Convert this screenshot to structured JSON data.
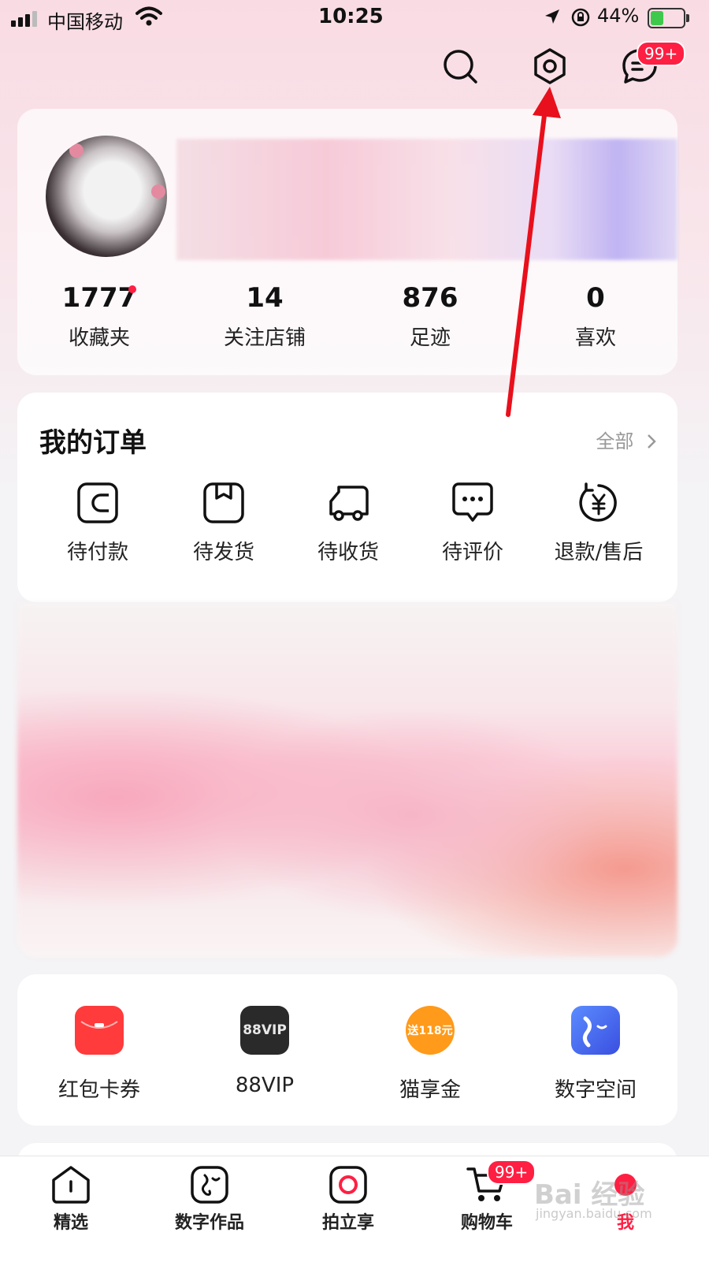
{
  "status_bar": {
    "carrier": "中国移动",
    "time": "10:25",
    "battery_percent": "44%",
    "battery_level": 0.44
  },
  "header": {
    "icons": [
      "search-icon",
      "gear-icon",
      "message-icon"
    ],
    "message_badge": "99+"
  },
  "profile": {
    "stats": [
      {
        "value": "1777",
        "label": "收藏夹"
      },
      {
        "value": "14",
        "label": "关注店铺"
      },
      {
        "value": "876",
        "label": "足迹"
      },
      {
        "value": "0",
        "label": "喜欢"
      }
    ]
  },
  "orders": {
    "title": "我的订单",
    "all_label": "全部",
    "items": [
      {
        "label": "待付款",
        "icon": "wallet-icon"
      },
      {
        "label": "待发货",
        "icon": "box-icon"
      },
      {
        "label": "待收货",
        "icon": "truck-icon"
      },
      {
        "label": "待评价",
        "icon": "comment-icon"
      },
      {
        "label": "退款/售后",
        "icon": "refund-icon"
      }
    ]
  },
  "services": [
    {
      "label": "红包卡券",
      "icon": "red-envelope-icon",
      "color": "#ff3b3b"
    },
    {
      "label": "88VIP",
      "icon": "vip-icon",
      "icon_text": "88VIP",
      "color": "#222222"
    },
    {
      "label": "猫享金",
      "icon": "coin-icon",
      "icon_text": "送118元",
      "color": "#ff8a00"
    },
    {
      "label": "数字空间",
      "icon": "digital-space-icon",
      "color": "#3a6df0"
    }
  ],
  "tabbar": {
    "items": [
      {
        "label": "精选",
        "icon": "home-icon"
      },
      {
        "label": "数字作品",
        "icon": "art-icon"
      },
      {
        "label": "拍立享",
        "icon": "camera-icon"
      },
      {
        "label": "购物车",
        "icon": "cart-icon",
        "badge": "99+"
      },
      {
        "label": "我",
        "icon": "me-icon"
      }
    ]
  },
  "watermark": {
    "text": "Bai 经验",
    "sub": "jingyan.baidu.com"
  },
  "colors": {
    "accent": "#ff1f43",
    "annotation_arrow": "#e8101c"
  }
}
